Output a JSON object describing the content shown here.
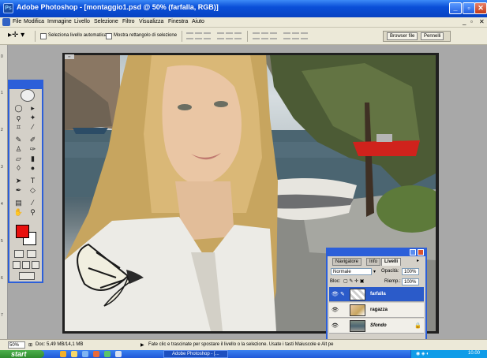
{
  "window": {
    "title": "Adobe Photoshop - [montaggio1.psd @ 50% (farfalla, RGB)]",
    "app_icon": "photoshop-icon",
    "minimize": "_",
    "maximize": "▫",
    "close": "✕"
  },
  "menu": {
    "items": [
      "File",
      "Modifica",
      "Immagine",
      "Livello",
      "Selezione",
      "Filtro",
      "Visualizza",
      "Finestra",
      "Aiuto"
    ],
    "doc_min": "_",
    "doc_max": "▫",
    "doc_close": "✕"
  },
  "options": {
    "tool_icon": "move-tool-icon",
    "auto_select_label": "Seleziona livello automatica",
    "show_bounds_label": "Mostra rettangolo di selezione",
    "auto_select_checked": false,
    "show_bounds_checked": false
  },
  "palette_well": {
    "tabs": [
      "Browser file",
      "Pennelli"
    ]
  },
  "ruler": {
    "marks": [
      "0",
      "1",
      "2",
      "3",
      "4",
      "5",
      "6",
      "7"
    ]
  },
  "tools": {
    "colors": {
      "foreground": "#e8100e",
      "background": "#ffffff"
    }
  },
  "layers_panel": {
    "tabs": [
      "Navigatore",
      "Info",
      "Livelli"
    ],
    "blend_mode": "Normale",
    "opacity_label": "Opacità:",
    "opacity_value": "100%",
    "lock_label": "Bloc:",
    "fill_label": "Riemp.:",
    "fill_value": "100%",
    "layers": [
      {
        "name": "farfalla",
        "selected": true,
        "italic": false
      },
      {
        "name": "ragazza",
        "selected": false,
        "italic": false
      },
      {
        "name": "Sfondo",
        "selected": false,
        "italic": true
      }
    ]
  },
  "status": {
    "zoom": "50%",
    "doc_info": "Doc: 5,49 MB/14,1 MB",
    "hint": "Fate clic e trascinate per spostare il livello o la selezione. Usate i tasti Maiuscole e Alt pe"
  },
  "taskbar": {
    "start_label": "start",
    "task_label": "Adobe Photoshop - [...",
    "clock": "10.00"
  }
}
